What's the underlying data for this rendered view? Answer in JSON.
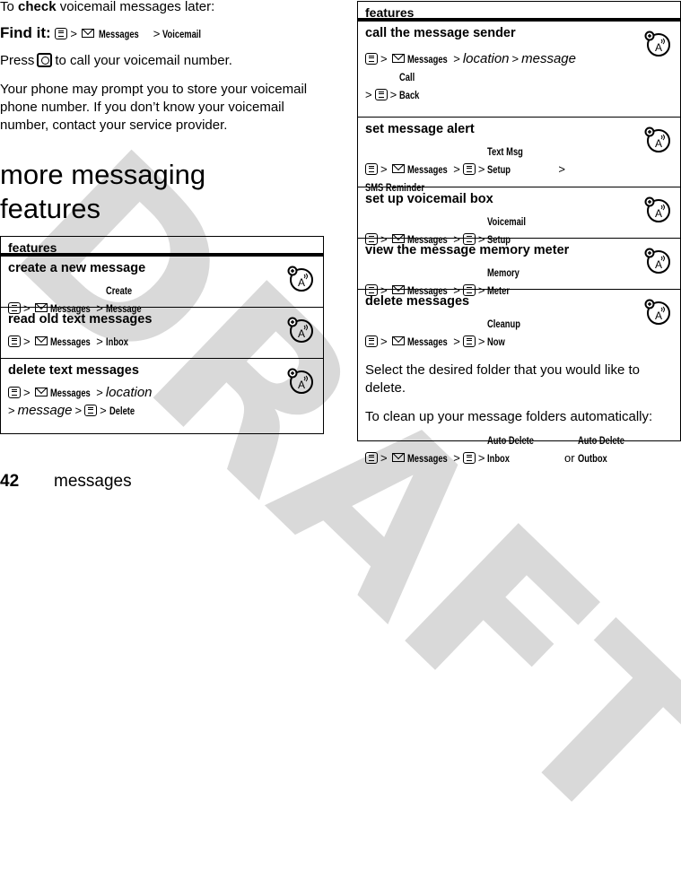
{
  "watermark": "DRAFT",
  "intro": {
    "check_prefix": "To ",
    "check_bold": "check",
    "check_suffix": " voicemail messages later:",
    "find_it_label": "Find it:",
    "find_it_path": [
      "Messages",
      "Voicemail"
    ],
    "press_prefix": "Press",
    "press_suffix": "to call your voicemail number.",
    "prompt_text": "Your phone may prompt you to store your voicemail phone number. If you don’t know your voicemail number, contact your service provider."
  },
  "section_title_line1": "more messaging",
  "section_title_line2": "features",
  "icons": {
    "menu_key": "menu-key-icon",
    "messages": "envelope-icon",
    "voicemail_key": "voicemail-key-icon",
    "network_feature": "network-feature-icon"
  },
  "left_table": {
    "header": "features",
    "rows": [
      {
        "title": "create a new message",
        "messages": "Messages",
        "dest": "Create Message"
      },
      {
        "title": "read old text messages",
        "messages": "Messages",
        "dest": "Inbox"
      },
      {
        "title": "delete text messages",
        "messages": "Messages",
        "loc": "location",
        "msg": "message",
        "dest": "Delete"
      }
    ]
  },
  "right_table": {
    "header": "features",
    "rows": [
      {
        "title": "call the message sender",
        "messages": "Messages",
        "loc": "location",
        "msg": "message",
        "dest": "Call Back"
      },
      {
        "title": "set message alert",
        "messages": "Messages",
        "sub": "Text Msg Setup",
        "dest": "SMS Reminder"
      },
      {
        "title": "set up voicemail box",
        "messages": "Messages",
        "dest": "Voicemail Setup"
      },
      {
        "title": "view the message memory meter",
        "messages": "Messages",
        "dest": "Memory Meter"
      },
      {
        "title": "delete messages",
        "messages": "Messages",
        "dest": "Cleanup Now",
        "note1": "Select the desired folder that you would like to delete.",
        "note2": "To clean up your message folders automatically:",
        "auto1": "Auto Delete Inbox",
        "or": "or",
        "auto2": "Auto Delete Outbox"
      }
    ]
  },
  "sep": ">",
  "footer": {
    "page_number": "42",
    "section": "messages"
  }
}
